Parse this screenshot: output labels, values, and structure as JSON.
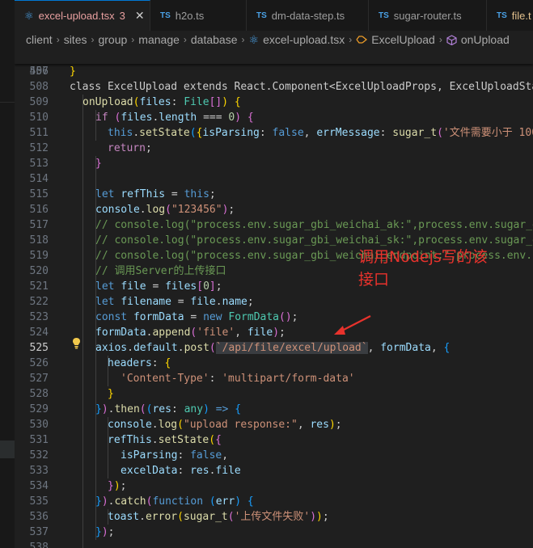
{
  "tabs": [
    {
      "label": "excel-upload.tsx",
      "icon": "react-icon",
      "badge": "3",
      "active": true
    },
    {
      "label": "h2o.ts",
      "icon": "ts-icon"
    },
    {
      "label": "dm-data-step.ts",
      "icon": "ts-icon"
    },
    {
      "label": "sugar-router.ts",
      "icon": "ts-icon"
    },
    {
      "label": "file.t",
      "icon": "ts-icon"
    }
  ],
  "icons": {
    "ts": "TS",
    "react": "⚛",
    "close": "✕",
    "chevron": "›",
    "bulb": "lightbulb-icon"
  },
  "breadcrumb": [
    "client",
    "sites",
    "group",
    "manage",
    "database",
    "excel-upload.tsx",
    "ExcelUpload",
    "onUpload"
  ],
  "annotation": {
    "line1": "调用Nodejs写的该",
    "line2": "接口"
  },
  "colors": {
    "keyword": "#569cd6",
    "string": "#ce9178",
    "comment": "#6a9955",
    "annotation": "#e8322c"
  },
  "code": {
    "sticky": {
      "num": "456",
      "text": "class ExcelUpload extends React.Component<ExcelUploadProps, ExcelUploadState"
    },
    "l507": "507",
    "l508": "508",
    "l509": "509",
    "l510": "510",
    "l511": "511",
    "l512": "512",
    "l513": "513",
    "l514": "514",
    "l515": "515",
    "l516": "516",
    "l517": "517",
    "l518": "518",
    "l519": "519",
    "l520": "520",
    "l521": "521",
    "l522": "522",
    "l523": "523",
    "l524": "524",
    "l525": "525",
    "l526": "526",
    "l527": "527",
    "l528": "528",
    "l529": "529",
    "l530": "530",
    "l531": "531",
    "l532": "532",
    "l533": "533",
    "l534": "534",
    "l535": "535",
    "l536": "536",
    "l537": "537",
    "l538": "538",
    "str_msg": "'文件需要小于 100",
    "str_123": "\"123456\"",
    "cm517": "// console.log(\"process.env.sugar_gbi_weichai_ak:\",process.env.sugar_gb",
    "cm518": "// console.log(\"process.env.sugar_gbi_weichai_sk:\",process.env.sugar_gb",
    "cm519": "// console.log(\"process.env.sugar_gbi_weichai_endpoint:\",process.env.su",
    "cm520": "// 调用Server的上传接口",
    "str_file": "'file'",
    "url": "/api/file/excel/upload",
    "str_ct": "'Content-Type'",
    "str_mp": "'multipart/form-data'",
    "str_resp": "\"upload response:\"",
    "str_fail": "'上传文件失败'",
    "num0": "0"
  }
}
